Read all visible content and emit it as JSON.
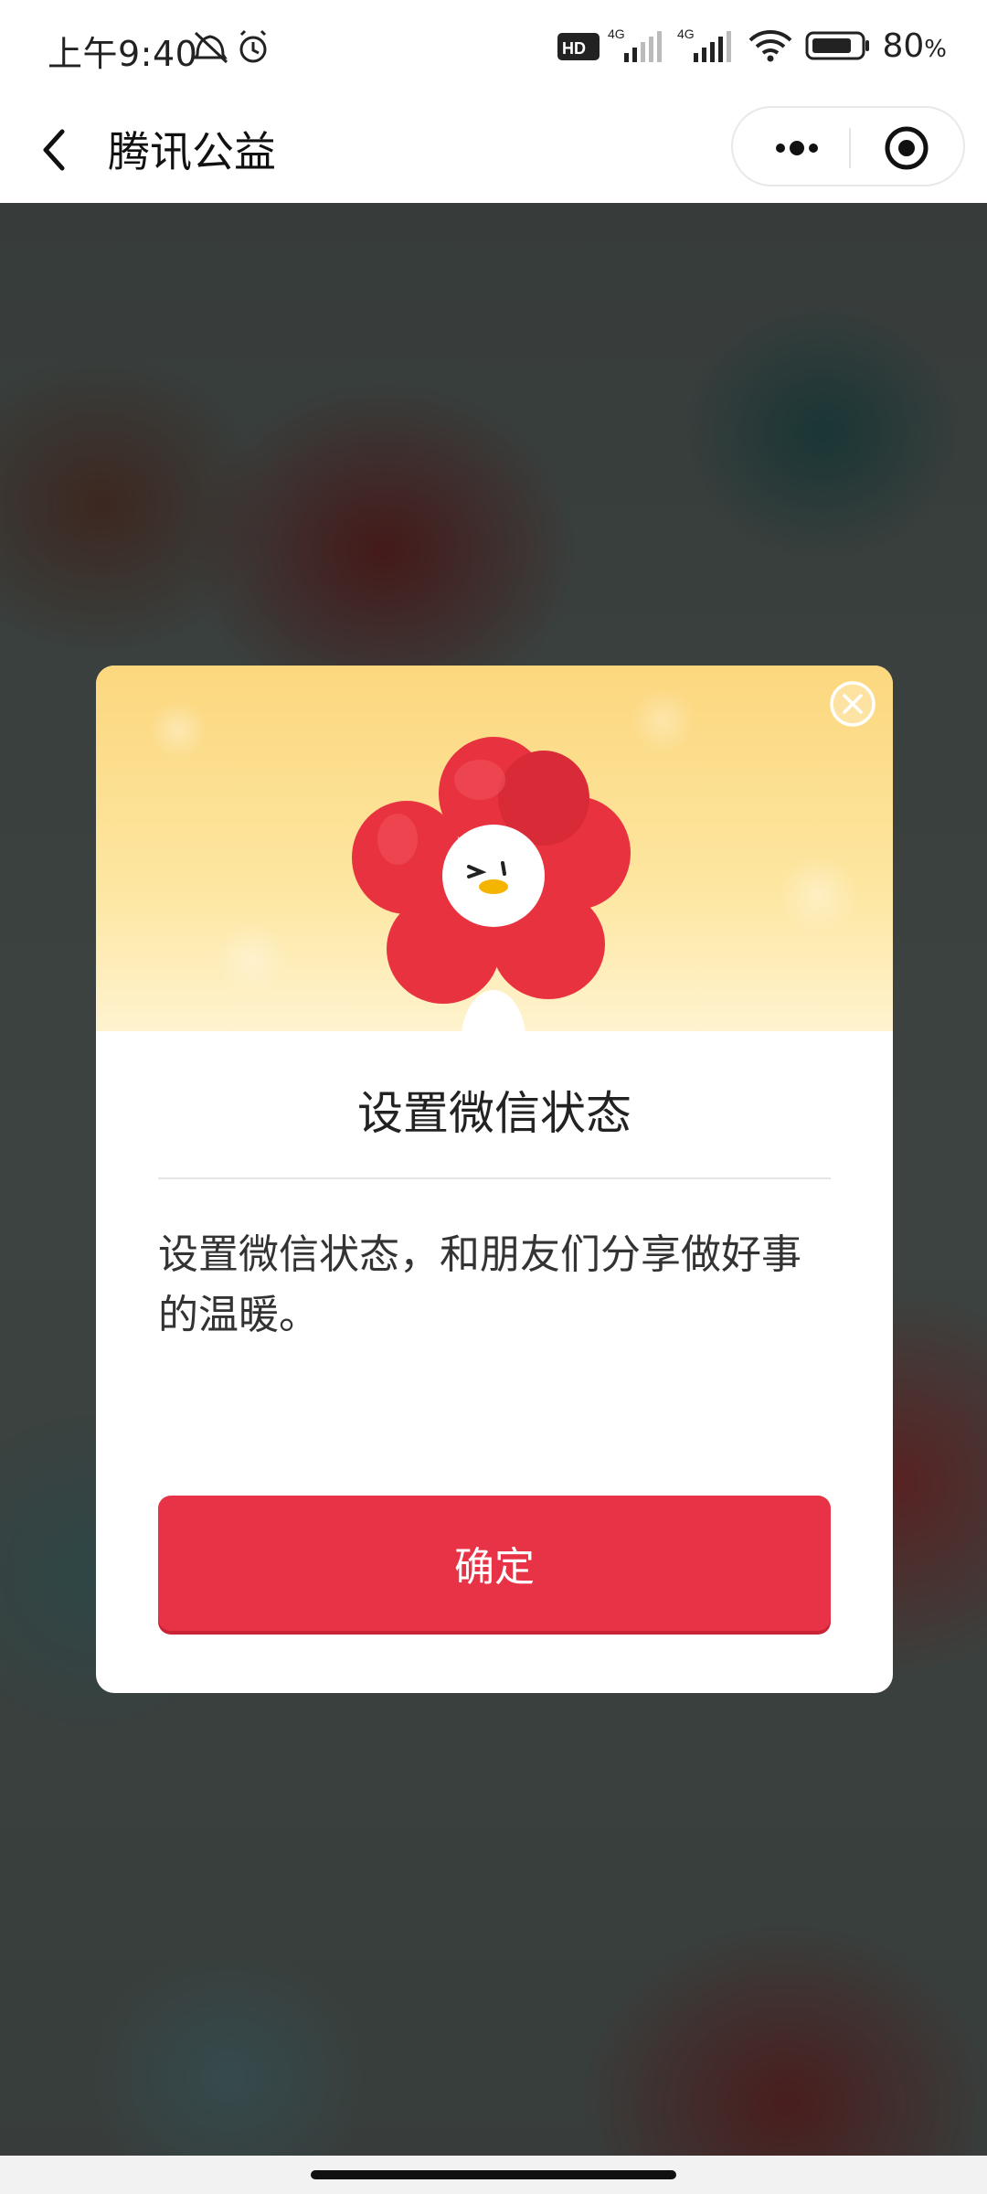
{
  "status_bar": {
    "time": "上午9:40",
    "network_1": "4G",
    "network_2": "4G",
    "hd_label": "HD",
    "battery_value": "80",
    "battery_unit": "%"
  },
  "nav": {
    "title": "腾讯公益",
    "back_icon": "chevron-left-icon",
    "more_icon": "more-dots-icon",
    "close_icon": "target-circle-icon"
  },
  "modal": {
    "title": "设置微信状态",
    "body": "设置微信状态，和朋友们分享做好事的温暖。",
    "confirm_label": "确定",
    "close_icon": "close-circle-icon"
  },
  "colors": {
    "accent": "#e83346",
    "hero_top": "#fcd77e",
    "hero_bottom": "#fef3cf",
    "flower_red": "#e8323f"
  }
}
